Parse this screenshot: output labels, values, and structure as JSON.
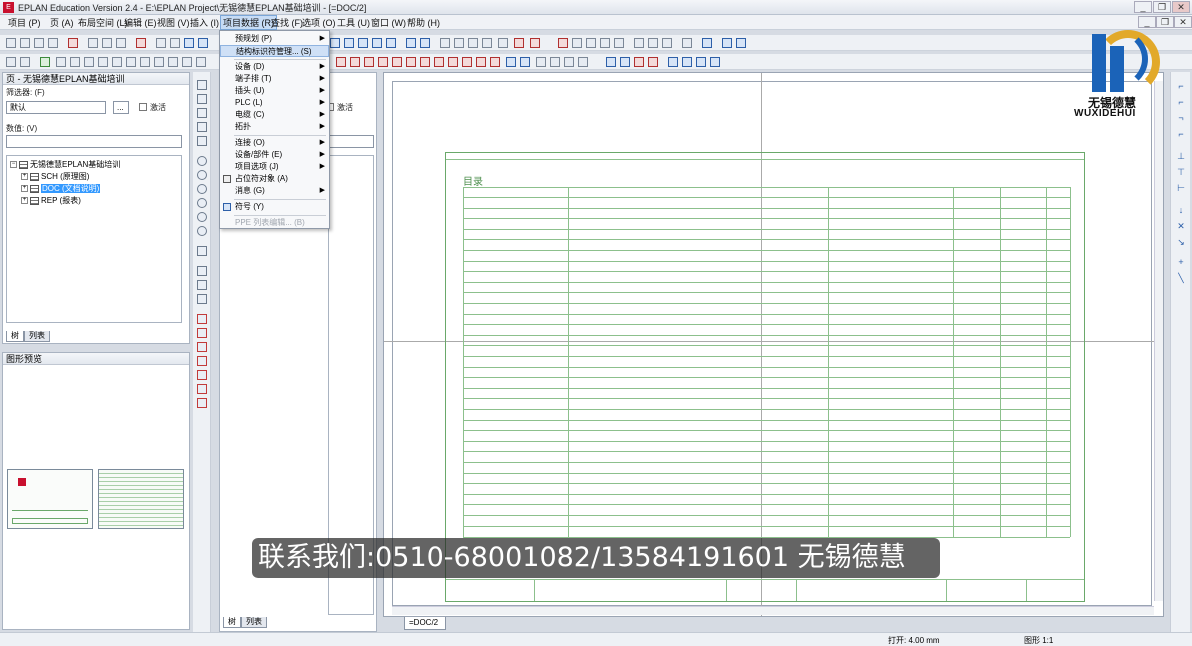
{
  "window": {
    "title": "EPLAN Education Version 2.4 - E:\\EPLAN Project\\无锡德慧EPLAN基础培训 - [=DOC/2]",
    "app_icon": "eplan-icon"
  },
  "menubar": {
    "items": [
      "项目 (P)",
      "页 (A)",
      "布局空间 (L)",
      "编辑 (E)",
      "视图 (V)",
      "插入 (I)",
      "项目数据 (R)",
      "查找 (F)",
      "选项 (O)",
      "工具 (U)",
      "窗口 (W)",
      "帮助 (H)"
    ],
    "active_index": 6
  },
  "project_data_menu": {
    "items": [
      {
        "label": "预规划 (P)",
        "submenu": true
      },
      {
        "label": "结构标识符管理... (S)",
        "submenu": false,
        "highlighted": true
      },
      {
        "label": "设备 (D)",
        "submenu": true
      },
      {
        "label": "端子排 (T)",
        "submenu": true
      },
      {
        "label": "插头 (U)",
        "submenu": true
      },
      {
        "label": "PLC (L)",
        "submenu": true
      },
      {
        "label": "电缆 (C)",
        "submenu": true
      },
      {
        "label": "拓扑",
        "submenu": true
      },
      {
        "label": "连接 (O)",
        "submenu": true
      },
      {
        "label": "设备/部件 (E)",
        "submenu": true
      },
      {
        "label": "项目选项 (J)",
        "submenu": true
      },
      {
        "label": "占位符对象 (A)",
        "submenu": false
      },
      {
        "label": "消息 (G)",
        "submenu": true
      },
      {
        "label": "符号 (Y)",
        "submenu": false
      },
      {
        "label": "PPE 列表编辑... (B)",
        "submenu": false,
        "disabled": true
      }
    ]
  },
  "page_navigator": {
    "header": "页 - 无锡德慧EPLAN基础培训",
    "filter_label": "筛选器: (F)",
    "filter_value": "默认",
    "filter_button": "...",
    "activate_label": "激活",
    "value_label": "数值: (V)",
    "tree": {
      "root": "无锡德慧EPLAN基础培训",
      "children": [
        {
          "label": "SCH (原理图)",
          "selected": false
        },
        {
          "label": "DOC (文档说明)",
          "selected": true
        },
        {
          "label": "REP (报表)",
          "selected": false
        }
      ]
    },
    "tabs": [
      "树",
      "列表"
    ]
  },
  "graphic_preview": {
    "header": "图形预览"
  },
  "mid_panel": {
    "activate_label": "激活",
    "tabs": [
      "树",
      "列表"
    ]
  },
  "document": {
    "tab_label": "=DOC/2",
    "sheet_title": "目录"
  },
  "status": {
    "open_label": "打开: 4.00 mm",
    "grid_label": "图形 1:1"
  },
  "watermark": {
    "text": "联系我们:0510-68001082/13584191601 无锡德慧"
  },
  "logo": {
    "cn": "无锡德慧",
    "en": "WUXIDEHUI"
  },
  "colors": {
    "accent": "#3399ff",
    "sheet_line": "#6aa86a",
    "logo_blue": "#1b63b8",
    "logo_gold": "#e2a92a"
  }
}
